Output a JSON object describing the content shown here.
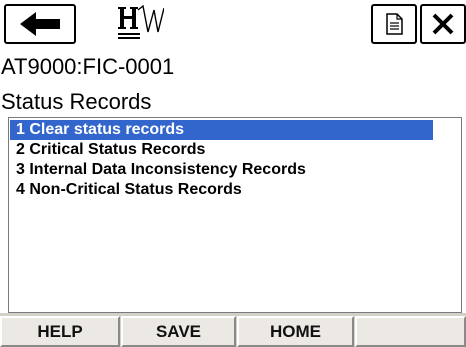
{
  "header": {
    "back_icon": "left-arrow-icon",
    "logo_icon": "hw-logo-icon",
    "doc_icon": "document-icon",
    "close_icon": "close-x-icon"
  },
  "device_title": "AT9000:FIC-0001",
  "section_title": "Status Records",
  "list": {
    "items": [
      {
        "label": "1 Clear status records",
        "selected": true
      },
      {
        "label": "2 Critical Status Records",
        "selected": false
      },
      {
        "label": "3 Internal Data Inconsistency Records",
        "selected": false
      },
      {
        "label": "4 Non-Critical Status Records",
        "selected": false
      }
    ],
    "selection_color": "#3366cc"
  },
  "softkeys": {
    "help": "HELP",
    "save": "SAVE",
    "home": "HOME",
    "blank": ""
  }
}
